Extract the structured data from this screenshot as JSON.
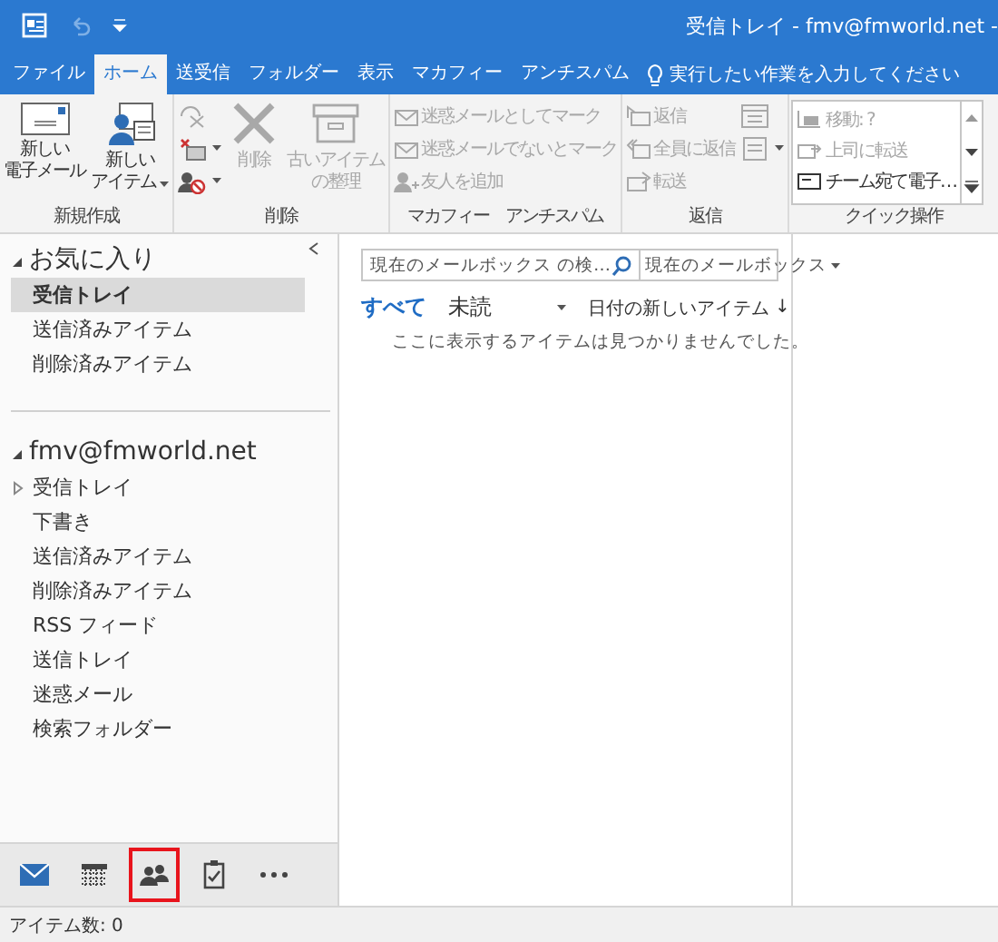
{
  "window": {
    "title": "受信トレイ - fmv@fmworld.net -"
  },
  "quick_access": {
    "undo_disabled": true
  },
  "tabs": [
    {
      "label": "ファイル",
      "selected": false
    },
    {
      "label": "ホーム",
      "selected": true
    },
    {
      "label": "送受信",
      "selected": false
    },
    {
      "label": "フォルダー",
      "selected": false
    },
    {
      "label": "表示",
      "selected": false
    },
    {
      "label": "マカフィー　アンチスパム",
      "selected": false
    }
  ],
  "tell_me": {
    "placeholder": "実行したい作業を入力してください"
  },
  "ribbon": {
    "groups": [
      {
        "label": "新規作成",
        "items": [
          {
            "kind": "large",
            "lines": [
              "新しい",
              "電子メール"
            ],
            "disabled": false,
            "dropdown": false
          },
          {
            "kind": "large",
            "lines": [
              "新しい",
              "アイテム"
            ],
            "disabled": false,
            "dropdown": true
          }
        ]
      },
      {
        "label": "削除",
        "items": [
          {
            "kind": "icon",
            "disabled": true,
            "dropdown": false
          },
          {
            "kind": "icon",
            "disabled": false,
            "dropdown": true
          },
          {
            "kind": "icon",
            "disabled": false,
            "dropdown": true
          },
          {
            "kind": "large",
            "lines": [
              "削除"
            ],
            "disabled": true,
            "dropdown": false
          },
          {
            "kind": "large",
            "lines": [
              "古いアイテム",
              "の整理"
            ],
            "disabled": true,
            "dropdown": false
          }
        ]
      },
      {
        "label": "マカフィー　アンチスパム",
        "items": [
          {
            "kind": "small",
            "label": "迷惑メールとしてマーク",
            "disabled": true,
            "dropdown": false
          },
          {
            "kind": "small",
            "label": "迷惑メールでないとマーク",
            "disabled": true,
            "dropdown": false
          },
          {
            "kind": "small",
            "label": "友人を追加",
            "disabled": true,
            "dropdown": false
          }
        ]
      },
      {
        "label": "返信",
        "items": [
          {
            "kind": "small",
            "label": "返信",
            "disabled": true,
            "dropdown": false
          },
          {
            "kind": "small",
            "label": "全員に返信",
            "disabled": true,
            "dropdown": false
          },
          {
            "kind": "small",
            "label": "転送",
            "disabled": true,
            "dropdown": false
          },
          {
            "kind": "icon",
            "disabled": true,
            "dropdown": false
          },
          {
            "kind": "icon",
            "disabled": true,
            "dropdown": true
          }
        ]
      },
      {
        "label": "クイック操作",
        "items": [
          {
            "kind": "gallery",
            "label": "移動: ?",
            "disabled": true
          },
          {
            "kind": "gallery",
            "label": "上司に転送",
            "disabled": true
          },
          {
            "kind": "gallery",
            "label": "チーム宛て電子…",
            "disabled": false
          }
        ]
      }
    ]
  },
  "folder_pane": {
    "sections": [
      {
        "title": "お気に入り",
        "expanded": true,
        "items": [
          {
            "label": "受信トレイ",
            "selected": true
          },
          {
            "label": "送信済みアイテム",
            "selected": false
          },
          {
            "label": "削除済みアイテム",
            "selected": false
          }
        ]
      },
      {
        "title": "fmv@fmworld.net",
        "expanded": true,
        "items": [
          {
            "label": "受信トレイ",
            "selected": false,
            "expanded": false
          },
          {
            "label": "下書き",
            "selected": false
          },
          {
            "label": "送信済みアイテム",
            "selected": false
          },
          {
            "label": "削除済みアイテム",
            "selected": false
          },
          {
            "label": "RSS フィード",
            "selected": false
          },
          {
            "label": "送信トレイ",
            "selected": false
          },
          {
            "label": "迷惑メール",
            "selected": false
          },
          {
            "label": "検索フォルダー",
            "selected": false
          }
        ]
      }
    ]
  },
  "message_list": {
    "search": {
      "placeholder": "現在のメールボックス の検…"
    },
    "scope": "現在のメールボックス",
    "filters": [
      {
        "label": "すべて",
        "selected": true
      },
      {
        "label": "未読",
        "selected": false
      }
    ],
    "sort": "日付の新しいアイテム",
    "sort_arrow": "↓",
    "empty_message": "ここに表示するアイテムは見つかりませんでした。"
  },
  "nav_bar": {
    "items": [
      {
        "kind": "mail",
        "selected": true,
        "highlighted": false
      },
      {
        "kind": "calendar",
        "selected": false,
        "highlighted": false
      },
      {
        "kind": "people",
        "selected": false,
        "highlighted": true
      },
      {
        "kind": "tasks",
        "selected": false,
        "highlighted": false
      },
      {
        "kind": "more",
        "selected": false,
        "highlighted": false
      }
    ]
  },
  "status_bar": {
    "text": "アイテム数: 0"
  }
}
